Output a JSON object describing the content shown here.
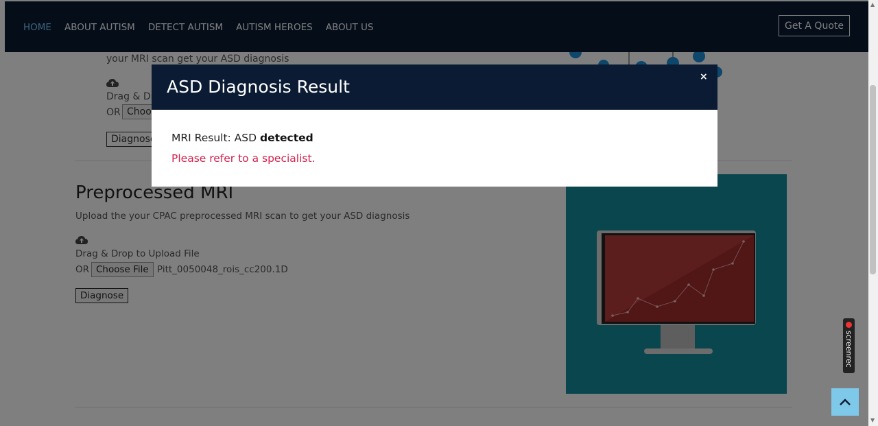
{
  "nav": {
    "items": [
      "HOME",
      "ABOUT AUTISM",
      "DETECT AUTISM",
      "AUTISM HEROES",
      "ABOUT US"
    ],
    "cta_label": "Get A Quote"
  },
  "upper_section": {
    "text": "your MRI scan get your ASD diagnosis",
    "drag_text": "Drag & Dr",
    "or_text": "OR",
    "choose_label": "Choo",
    "diagnose_label": "Diagnose"
  },
  "preprocessed": {
    "title": "Preprocessed MRI",
    "description": "Upload the your CPAC preprocessed MRI scan to get your ASD diagnosis",
    "drag_text": "Drag & Drop to Upload File",
    "or_text": "OR",
    "choose_label": "Choose File",
    "file_name": "Pitt_0050048_rois_cc200.1D",
    "diagnose_label": "Diagnose"
  },
  "modal": {
    "title": "ASD Diagnosis Result",
    "close_label": "×",
    "result_prefix": "MRI Result: ASD",
    "result_status": "detected",
    "warning": "Please refer to a specialist."
  },
  "widgets": {
    "screenrec_label": "screenrec",
    "back_to_top_icon": "chevron-up-icon"
  },
  "colors": {
    "navbar": "#0a1b33",
    "nav_active": "#7ec8ff",
    "warning": "#d6204a",
    "illustration_bg": "#138c9c",
    "monitor_screen": "#b83a3a",
    "back_to_top": "#7ec8ea"
  }
}
